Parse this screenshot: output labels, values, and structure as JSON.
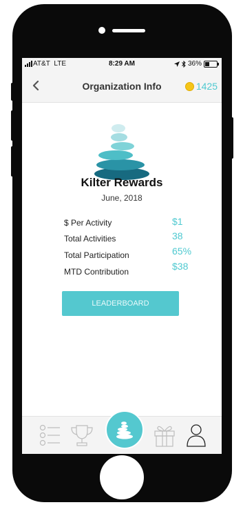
{
  "status_bar": {
    "carrier": "AT&T",
    "network": "LTE",
    "time": "8:29 AM",
    "battery": "36%"
  },
  "nav": {
    "title": "Organization Info",
    "points": "1425"
  },
  "org": {
    "name": "Kilter Rewards",
    "date": "June, 2018"
  },
  "stats": [
    {
      "label": "$ Per Activity",
      "value": "$1"
    },
    {
      "label": "Total Activities",
      "value": "38"
    },
    {
      "label": "Total Participation",
      "value": "65%"
    },
    {
      "label": "MTD Contribution",
      "value": "$38"
    }
  ],
  "leaderboard_label": "LEADERBOARD",
  "tabs": [
    {
      "icon": "list-icon"
    },
    {
      "icon": "trophy-icon"
    },
    {
      "icon": "stones-icon"
    },
    {
      "icon": "gift-icon"
    },
    {
      "icon": "profile-icon"
    }
  ],
  "colors": {
    "accent": "#54c8cf",
    "points_text": "#4ec9d0",
    "coin": "#f5c518"
  }
}
